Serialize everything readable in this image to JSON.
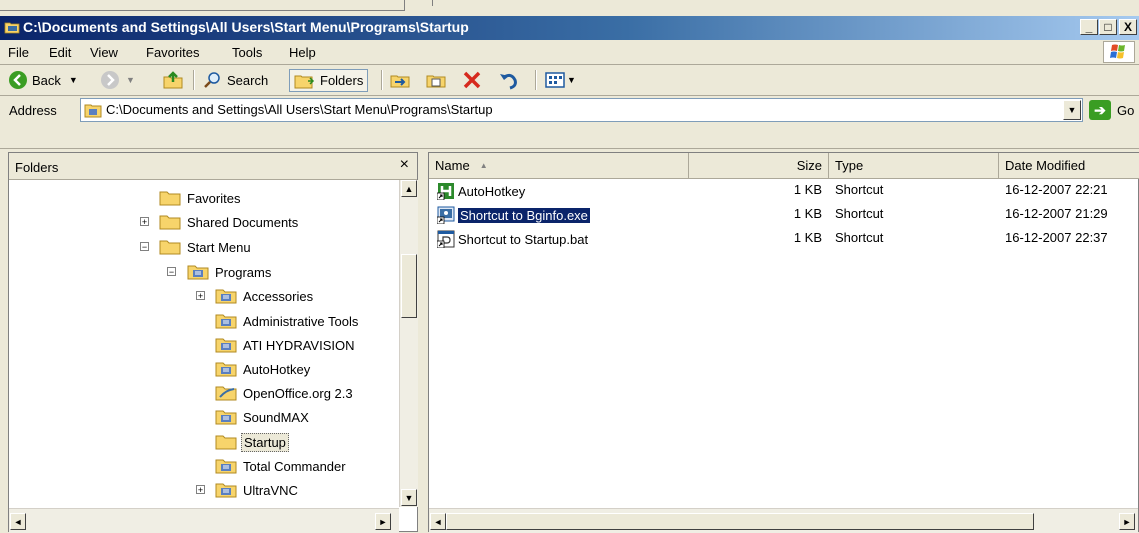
{
  "window": {
    "title": "C:\\Documents and Settings\\All Users\\Start Menu\\Programs\\Startup",
    "min": "_",
    "max": "□",
    "close": "X"
  },
  "menu": [
    "File",
    "Edit",
    "View",
    "Favorites",
    "Tools",
    "Help"
  ],
  "toolbar": {
    "back": "Back",
    "search": "Search",
    "folders": "Folders"
  },
  "address": {
    "label": "Address",
    "value": "C:\\Documents and Settings\\All Users\\Start Menu\\Programs\\Startup",
    "go": "Go"
  },
  "folders_pane": {
    "title": "Folders",
    "close": "×",
    "items": [
      {
        "label": "Favorites",
        "expander": ""
      },
      {
        "label": "Shared Documents",
        "expander": "+"
      },
      {
        "label": "Start Menu",
        "expander": "−"
      },
      {
        "label": "Programs",
        "expander": "−"
      },
      {
        "label": "Accessories",
        "expander": "+"
      },
      {
        "label": "Administrative Tools",
        "expander": ""
      },
      {
        "label": "ATI HYDRAVISION",
        "expander": ""
      },
      {
        "label": "AutoHotkey",
        "expander": ""
      },
      {
        "label": "OpenOffice.org 2.3",
        "expander": ""
      },
      {
        "label": "SoundMAX",
        "expander": ""
      },
      {
        "label": "Startup",
        "expander": ""
      },
      {
        "label": "Total Commander",
        "expander": ""
      },
      {
        "label": "UltraVNC",
        "expander": "+"
      }
    ]
  },
  "file_list": {
    "columns": [
      "Name",
      "Size",
      "Type",
      "Date Modified"
    ],
    "rows": [
      {
        "name": "AutoHotkey",
        "size": "1 KB",
        "type": "Shortcut",
        "date": "16-12-2007 22:21"
      },
      {
        "name": "Shortcut to Bginfo.exe",
        "size": "1 KB",
        "type": "Shortcut",
        "date": "16-12-2007 21:29"
      },
      {
        "name": "Shortcut to Startup.bat",
        "size": "1 KB",
        "type": "Shortcut",
        "date": "16-12-2007 22:37"
      }
    ]
  },
  "colors": {
    "title_start": "#0a246a",
    "title_end": "#a6caf0",
    "selection": "#0a246a",
    "folder": "#f7d46b"
  }
}
